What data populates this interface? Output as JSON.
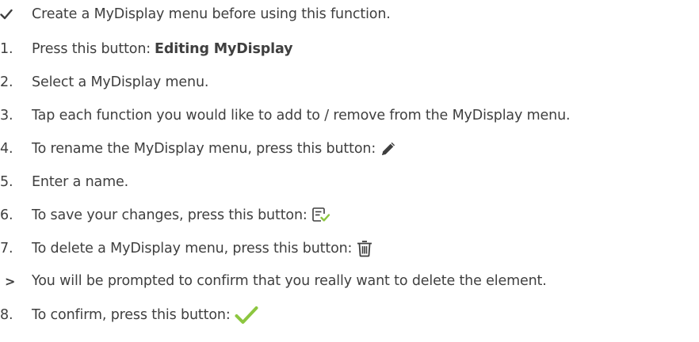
{
  "bullet": {
    "icon": "check-icon",
    "text": "Create a MyDisplay menu before using this function."
  },
  "steps": [
    {
      "number": "1.",
      "text": "Press this button:",
      "button_label": "Editing MyDisplay"
    },
    {
      "number": "2.",
      "text": "Select a MyDisplay menu."
    },
    {
      "number": "3.",
      "text": "Tap each function you would like to add to / remove from the MyDisplay menu."
    },
    {
      "number": "4.",
      "text": "To rename the MyDisplay menu, press this button:",
      "icon": "pencil-icon"
    },
    {
      "number": "5.",
      "text": "Enter a name."
    },
    {
      "number": "6.",
      "text": "To save your changes, press this button:",
      "icon": "save-list-check-icon"
    },
    {
      "number": "7.",
      "text": "To delete a MyDisplay menu, press this button:",
      "icon": "trash-icon"
    },
    {
      "number": "8.",
      "text": "To confirm, press this button:",
      "icon": "confirm-check-icon"
    }
  ],
  "result": {
    "marker": ">",
    "text": "You will be prompted to confirm that you really want to delete the element."
  },
  "colors": {
    "text": "#3f3f3f",
    "accent_green": "#8cc63f"
  }
}
